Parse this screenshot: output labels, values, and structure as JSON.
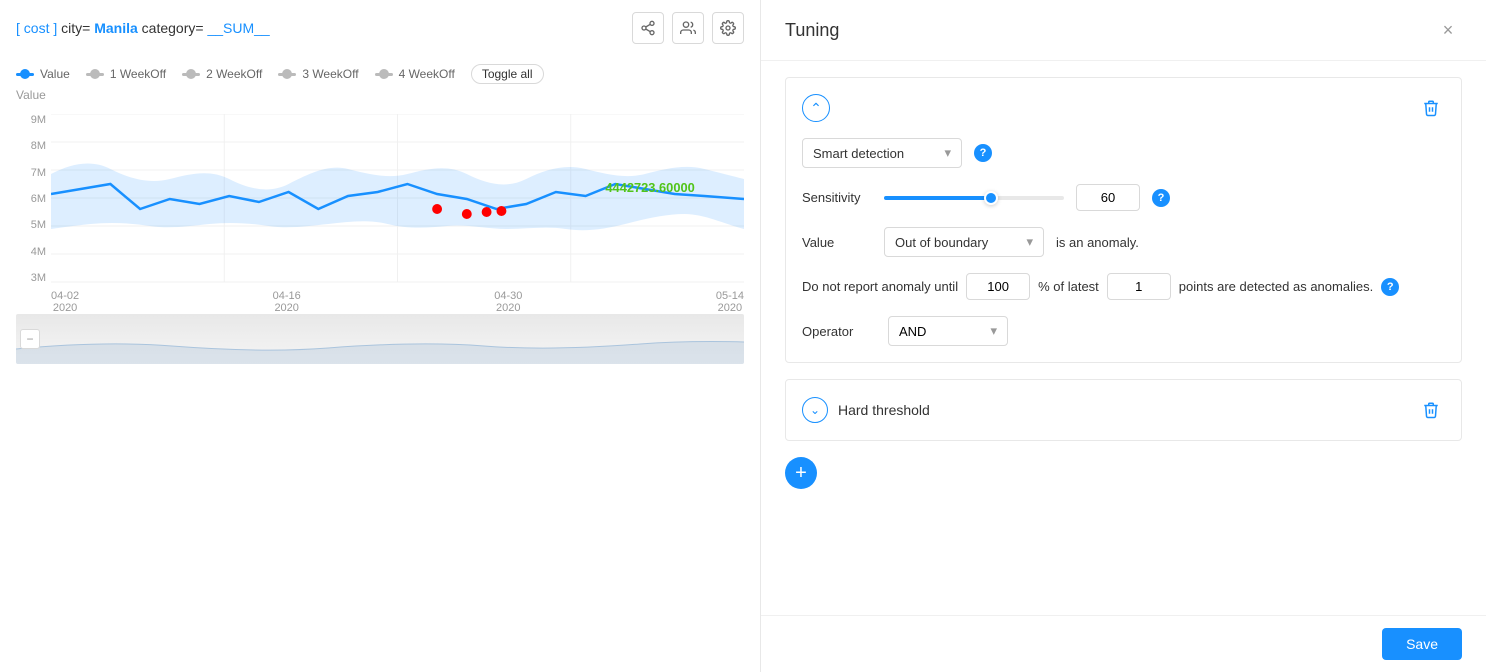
{
  "chart": {
    "title": {
      "prefix": "[ cost ]",
      "city_label": "city=",
      "city": "Manila",
      "category_label": "category=",
      "sum": "__SUM__"
    },
    "legend": {
      "value_label": "Value",
      "week_off_1": "1 WeekOff",
      "week_off_2": "2 WeekOff",
      "week_off_3": "3 WeekOff",
      "week_off_4": "4 WeekOff",
      "toggle_all": "Toggle all"
    },
    "y_axis": [
      "9M",
      "8M",
      "7M",
      "6M",
      "5M",
      "4M",
      "3M"
    ],
    "x_axis": [
      {
        "label": "04-02",
        "sub": "2020"
      },
      {
        "label": "04-16",
        "sub": "2020"
      },
      {
        "label": "04-30",
        "sub": "2020"
      },
      {
        "label": "05-14",
        "sub": "2020"
      }
    ],
    "value_label": "4442723.60000",
    "y_axis_title": "Value"
  },
  "tuning": {
    "title": "Tuning",
    "close_label": "×",
    "detection_method": {
      "label": "Smart detection",
      "collapse_icon": "chevron-up",
      "delete_icon": "trash-icon"
    },
    "sensitivity": {
      "label": "Sensitivity",
      "value": "60",
      "slider_percent": 60
    },
    "value_dropdown": {
      "label": "Value",
      "selected": "Out of boundary",
      "suffix": "is an anomaly."
    },
    "report": {
      "prefix": "Do not report anomaly until",
      "percent_value": "100",
      "percent_label": "% of latest",
      "points_value": "1",
      "suffix": "points are detected as anomalies."
    },
    "operator": {
      "label": "Operator",
      "selected": "AND"
    },
    "hard_threshold": {
      "label": "Hard threshold",
      "delete_icon": "trash-icon"
    },
    "add_button_label": "+",
    "save_button_label": "Save"
  }
}
